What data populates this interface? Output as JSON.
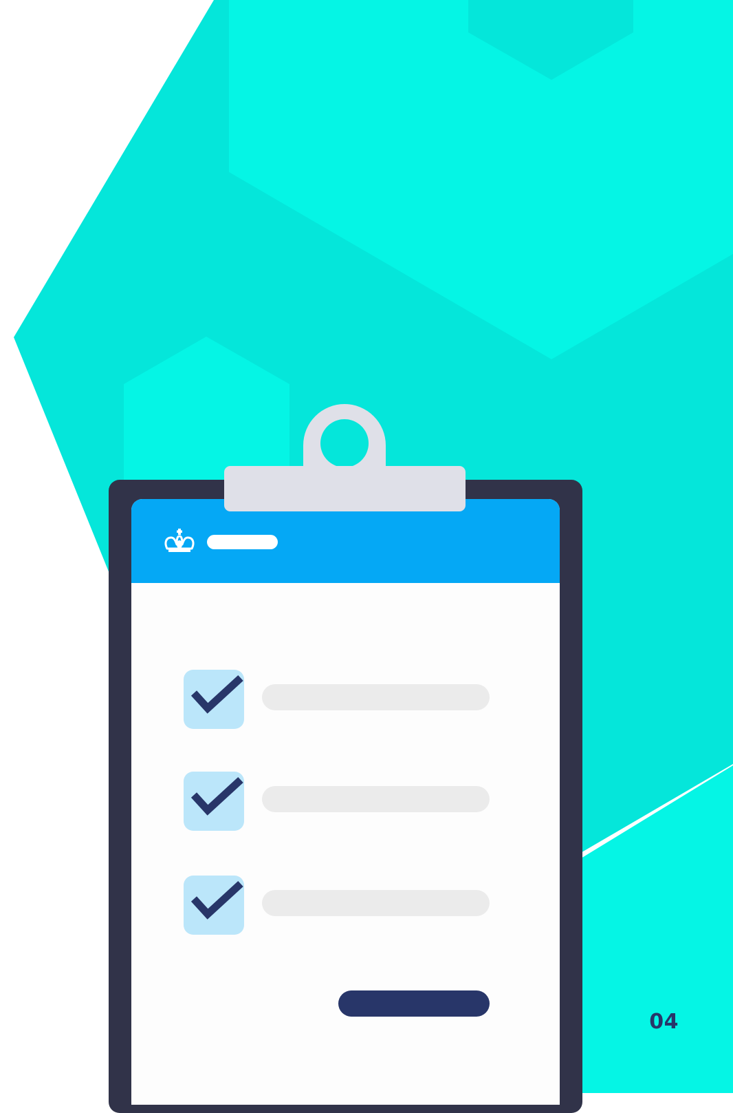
{
  "page_number": "04",
  "icons": {
    "header_logo": "crown-icon",
    "checkbox": "checkmark-icon",
    "clip": "clipboard-clip-icon"
  },
  "colors": {
    "background_teal": "#05f5e5",
    "background_teal_dark": "#05e6da",
    "board": "#313349",
    "header_blue": "#05a8f5",
    "checkbox_fill": "#bbe6fa",
    "checkmark": "#283669",
    "placeholder_line": "#ebebeb",
    "button": "#283669",
    "clip": "#dfe0e8"
  },
  "checklist": {
    "items": [
      {
        "checked": true
      },
      {
        "checked": true
      },
      {
        "checked": true
      }
    ]
  }
}
